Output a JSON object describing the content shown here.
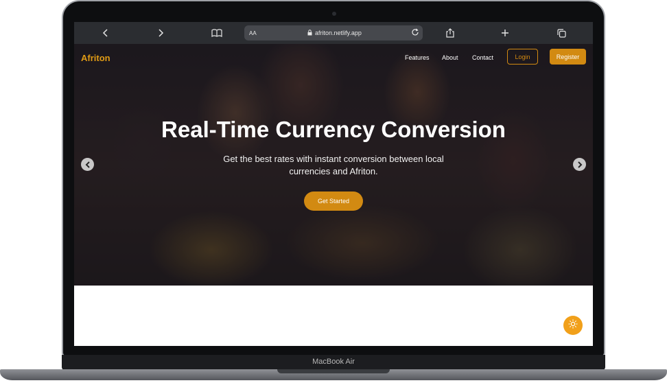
{
  "device": {
    "label": "MacBook Air"
  },
  "browser": {
    "url_prefix": "AA",
    "url": "afriton.netlify.app",
    "icons": [
      "back-icon",
      "forward-icon",
      "book-icon",
      "lock-icon",
      "reload-icon",
      "share-icon",
      "plus-icon",
      "tabs-icon"
    ]
  },
  "site": {
    "brand": "Afriton",
    "nav": {
      "features": "Features",
      "about": "About",
      "contact": "Contact"
    },
    "login": "Login",
    "register": "Register",
    "hero": {
      "title": "Real-Time Currency Conversion",
      "subtitle": "Get the best rates with instant conversion between local currencies and Afriton.",
      "cta": "Get Started"
    }
  },
  "colors": {
    "accent": "#d28a12",
    "fab": "#f1a01a",
    "brand": "#e09b15"
  }
}
